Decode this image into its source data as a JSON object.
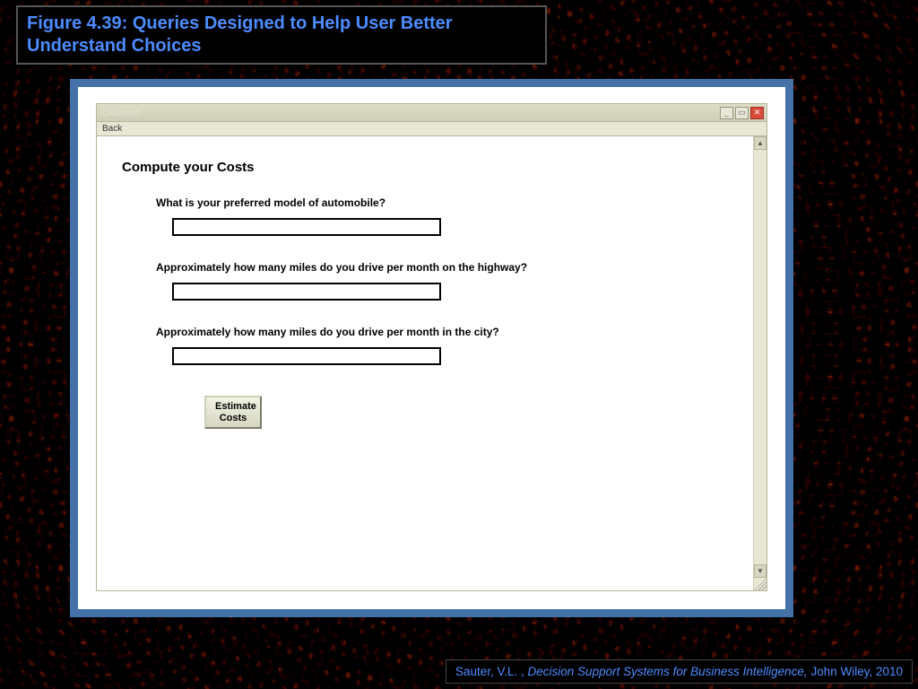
{
  "figure": {
    "label": "Figure 4.39:  Queries Designed to Help User Better Understand Choices"
  },
  "window": {
    "title": "Odabran",
    "menu_back": "Back"
  },
  "form": {
    "heading": "Compute your Costs",
    "q1_label": "What is your preferred model of automobile?",
    "q1_value": "",
    "q2_label": "Approximately how many miles do you drive per month on the highway?",
    "q2_value": "",
    "q3_label": "Approximately how many miles do you drive per month in the city?",
    "q3_value": "",
    "submit_line1": "Estimate",
    "submit_line2": "Costs"
  },
  "citation": {
    "author": "Sauter, V.L. , ",
    "title": "Decision Support Systems for Business Intelligence, ",
    "publisher": "John Wiley, 2010"
  }
}
